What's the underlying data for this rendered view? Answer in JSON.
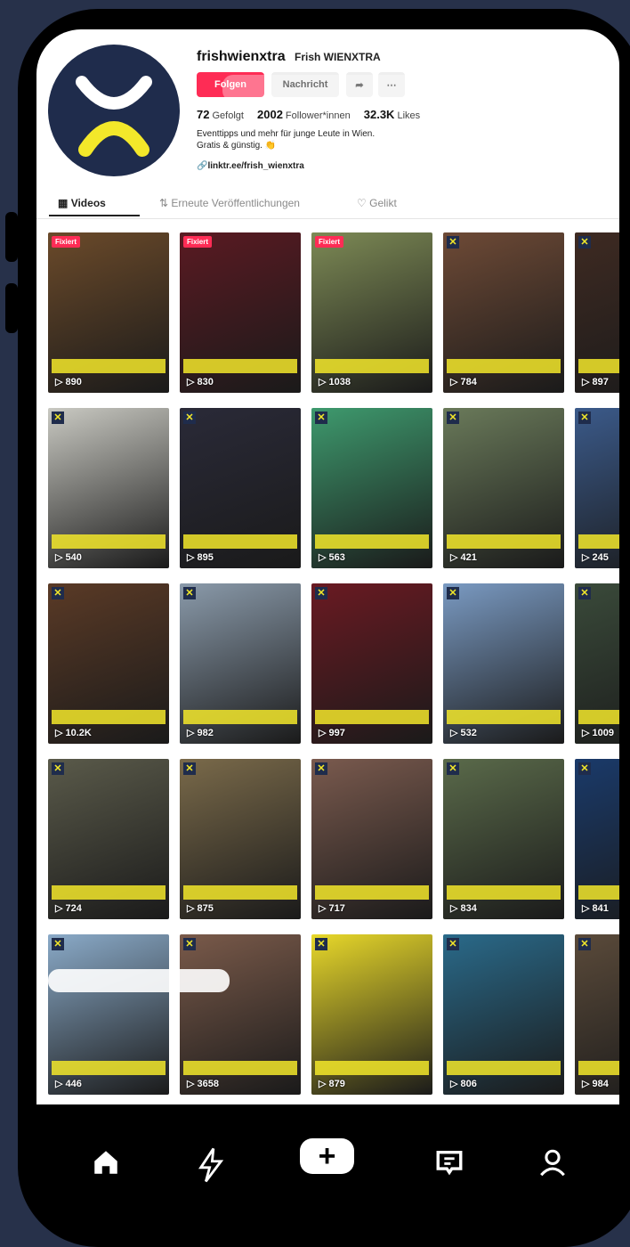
{
  "profile": {
    "username": "frishwienxtra",
    "display_name": "Frish WIENXTRA",
    "follow_label": "Folgen",
    "message_label": "Nachricht",
    "share_icon": "share-icon",
    "more_icon": "more-icon",
    "following_count": "72",
    "following_label": "Gefolgt",
    "followers_count": "2002",
    "followers_label": "Follower*innen",
    "likes_count": "32.3K",
    "likes_label": "Likes",
    "bio_line1": "Eventtipps und mehr für junge Leute in Wien.",
    "bio_line2": "Gratis & günstig. 👏",
    "link": "linktr.ee/frish_wienxtra"
  },
  "tabs": [
    {
      "label": "Videos",
      "icon": "grid-icon"
    },
    {
      "label": "Erneute Veröffentlichungen",
      "icon": "repost-icon"
    },
    {
      "label": "Gelikt",
      "icon": "heart-icon"
    }
  ],
  "videos": [
    {
      "views": "890",
      "badge": "Fixiert",
      "color": "#6b4a2a"
    },
    {
      "views": "830",
      "badge": "Fixiert",
      "color": "#5a1a22"
    },
    {
      "views": "1038",
      "badge": "Fixiert",
      "color": "#7d8a55"
    },
    {
      "views": "784",
      "badge": "",
      "color": "#6e4a36"
    },
    {
      "views": "897",
      "badge": "",
      "color": "#3e2a22"
    },
    {
      "views": "540",
      "badge": "",
      "color": "#c9c9c2"
    },
    {
      "views": "895",
      "badge": "",
      "color": "#2a2a38"
    },
    {
      "views": "563",
      "badge": "",
      "color": "#3e9a6e"
    },
    {
      "views": "421",
      "badge": "",
      "color": "#6a7a5a"
    },
    {
      "views": "245",
      "badge": "",
      "color": "#3b5a8a"
    },
    {
      "views": "10.2K",
      "badge": "",
      "color": "#5a3a26"
    },
    {
      "views": "982",
      "badge": "",
      "color": "#8a9aaa"
    },
    {
      "views": "997",
      "badge": "",
      "color": "#6a1a22"
    },
    {
      "views": "532",
      "badge": "",
      "color": "#7a9ac2"
    },
    {
      "views": "1009",
      "badge": "",
      "color": "#3a4a3a"
    },
    {
      "views": "724",
      "badge": "",
      "color": "#5a5a4a"
    },
    {
      "views": "875",
      "badge": "",
      "color": "#7a6a4a"
    },
    {
      "views": "717",
      "badge": "",
      "color": "#7a5a4e"
    },
    {
      "views": "834",
      "badge": "",
      "color": "#5a6a4a"
    },
    {
      "views": "841",
      "badge": "",
      "color": "#1a3a6a"
    },
    {
      "views": "446",
      "badge": "",
      "color": "#8aaac8"
    },
    {
      "views": "3658",
      "badge": "",
      "color": "#7a5a4a"
    },
    {
      "views": "879",
      "badge": "",
      "color": "#e8d82a"
    },
    {
      "views": "806",
      "badge": "",
      "color": "#2a6a8a"
    },
    {
      "views": "984",
      "badge": "",
      "color": "#5a4a3a"
    }
  ],
  "nav": [
    {
      "icon": "home-icon",
      "glyph": "⌂"
    },
    {
      "icon": "lightning-icon",
      "glyph": "ϟ"
    },
    {
      "icon": "create-icon",
      "glyph": "+"
    },
    {
      "icon": "inbox-icon",
      "glyph": "⊡"
    },
    {
      "icon": "profile-icon",
      "glyph": "⍝"
    }
  ],
  "colors": {
    "accent": "#fe2c55",
    "brand_navy": "#1f2c4c",
    "brand_yellow": "#f3e82a"
  }
}
